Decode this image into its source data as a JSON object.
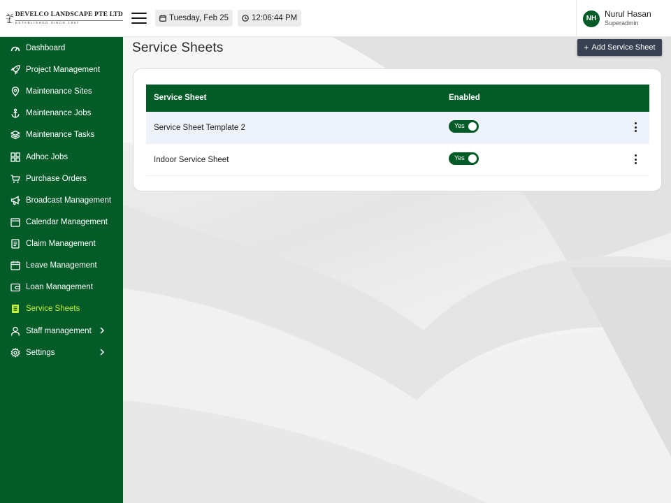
{
  "company": {
    "name": "DEVELCO LANDSCAPE PTE LTD",
    "tagline": "ESTABLISHED SINCE 1987"
  },
  "header": {
    "date": "Tuesday, Feb 25",
    "time": "12:06:44 PM",
    "user": {
      "initials": "NH",
      "name": "Nurul Hasan",
      "role": "Superadmin"
    }
  },
  "sidebar": {
    "items": [
      {
        "label": "Dashboard",
        "icon": "gauge-icon"
      },
      {
        "label": "Project Management",
        "icon": "rocket-icon"
      },
      {
        "label": "Maintenance Sites",
        "icon": "map-pin-icon"
      },
      {
        "label": "Maintenance Jobs",
        "icon": "anchor-icon"
      },
      {
        "label": "Maintenance Tasks",
        "icon": "layers-icon"
      },
      {
        "label": "Adhoc Jobs",
        "icon": "grid-icon"
      },
      {
        "label": "Purchase Orders",
        "icon": "cart-icon"
      },
      {
        "label": "Broadcast Management",
        "icon": "megaphone-icon"
      },
      {
        "label": "Calendar Management",
        "icon": "calendar-icon"
      },
      {
        "label": "Claim Management",
        "icon": "document-icon"
      },
      {
        "label": "Leave Management",
        "icon": "calendar-icon"
      },
      {
        "label": "Loan Management",
        "icon": "wallet-icon"
      },
      {
        "label": "Service Sheets",
        "icon": "sheet-icon",
        "active": true
      },
      {
        "label": "Staff management",
        "icon": "user-icon",
        "has_submenu": true
      },
      {
        "label": "Settings",
        "icon": "gear-icon",
        "has_submenu": true
      }
    ]
  },
  "page": {
    "title": "Service Sheets",
    "add_button": "Add Service Sheet"
  },
  "table": {
    "columns": [
      "Service Sheet",
      "Enabled"
    ],
    "rows": [
      {
        "name": "Service Sheet Template 2",
        "enabled": "Yes"
      },
      {
        "name": "Indoor Service Sheet",
        "enabled": "Yes"
      }
    ]
  },
  "colors": {
    "brand_green": "#035b27",
    "active_nav": "#c8f03b",
    "button_dark": "#374151",
    "row_alt": "#eef2fa"
  }
}
